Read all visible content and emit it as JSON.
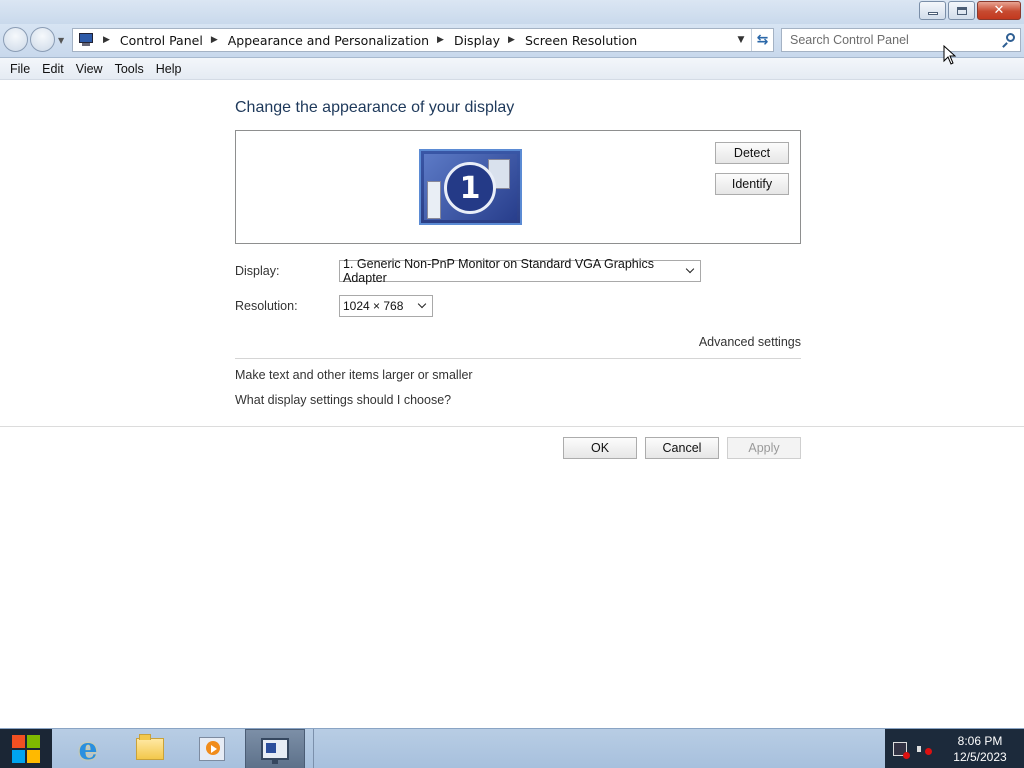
{
  "window": {
    "buttons": {
      "minimize": "minimize",
      "maximize": "restore",
      "close": "close"
    }
  },
  "address": {
    "crumbs": [
      "Control Panel",
      "Appearance and Personalization",
      "Display",
      "Screen Resolution"
    ],
    "search_placeholder": "Search Control Panel"
  },
  "menu": [
    "File",
    "Edit",
    "View",
    "Tools",
    "Help"
  ],
  "main": {
    "heading": "Change the appearance of your display",
    "monitor_number": "1",
    "detect_label": "Detect",
    "identify_label": "Identify",
    "display_label": "Display:",
    "display_value": "1. Generic Non-PnP Monitor on Standard VGA Graphics Adapter",
    "resolution_label": "Resolution:",
    "resolution_value": "1024 × 768",
    "advanced_link": "Advanced settings",
    "link_text_size": "Make text and other items larger or smaller",
    "link_display_help": "What display settings should I choose?",
    "ok_label": "OK",
    "cancel_label": "Cancel",
    "apply_label": "Apply"
  },
  "taskbar": {
    "apps": [
      "internet-explorer",
      "windows-explorer",
      "windows-media-player",
      "screen-resolution"
    ],
    "clock_time": "8:06 PM",
    "clock_date": "12/5/2023"
  },
  "colors": {
    "heading": "#1e395b",
    "close_button": "#c74a30",
    "taskbar": "#a7c0dd"
  }
}
